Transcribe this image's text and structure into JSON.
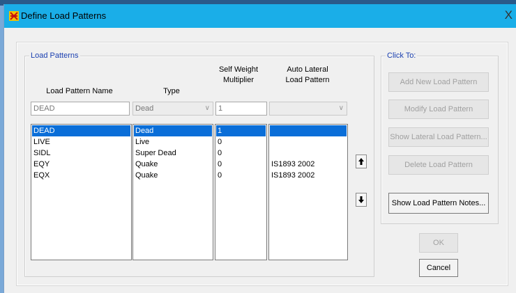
{
  "window": {
    "title": "Define Load Patterns",
    "close_glyph": "X",
    "icon": "etabs-app-icon"
  },
  "load_patterns": {
    "group_label": "Load Patterns",
    "headers": {
      "name": "Load Pattern Name",
      "type": "Type",
      "self_weight_1": "Self Weight",
      "self_weight_2": "Multiplier",
      "auto_lateral_1": "Auto Lateral",
      "auto_lateral_2": "Load Pattern"
    },
    "inputs": {
      "name": "DEAD",
      "type": "Dead",
      "self_weight": "1",
      "auto_lateral": ""
    },
    "rows": [
      {
        "name": "DEAD",
        "type": "Dead",
        "multiplier": "1",
        "auto_lateral": "",
        "selected": true
      },
      {
        "name": "LIVE",
        "type": "Live",
        "multiplier": "0",
        "auto_lateral": ""
      },
      {
        "name": "SIDL",
        "type": "Super Dead",
        "multiplier": "0",
        "auto_lateral": ""
      },
      {
        "name": "EQY",
        "type": "Quake",
        "multiplier": "0",
        "auto_lateral": "IS1893 2002"
      },
      {
        "name": "EQX",
        "type": "Quake",
        "multiplier": "0",
        "auto_lateral": "IS1893 2002"
      }
    ]
  },
  "click_to": {
    "group_label": "Click To:",
    "add": "Add New Load Pattern",
    "modify": "Modify Load Pattern",
    "show_lateral": "Show Lateral Load Pattern...",
    "delete": "Delete Load Pattern",
    "show_notes": "Show Load Pattern Notes..."
  },
  "buttons": {
    "ok": "OK",
    "cancel": "Cancel"
  },
  "colors": {
    "titlebar": "#1aaee8",
    "selection": "#0a6ed8",
    "group_label": "#1a3fb0"
  }
}
